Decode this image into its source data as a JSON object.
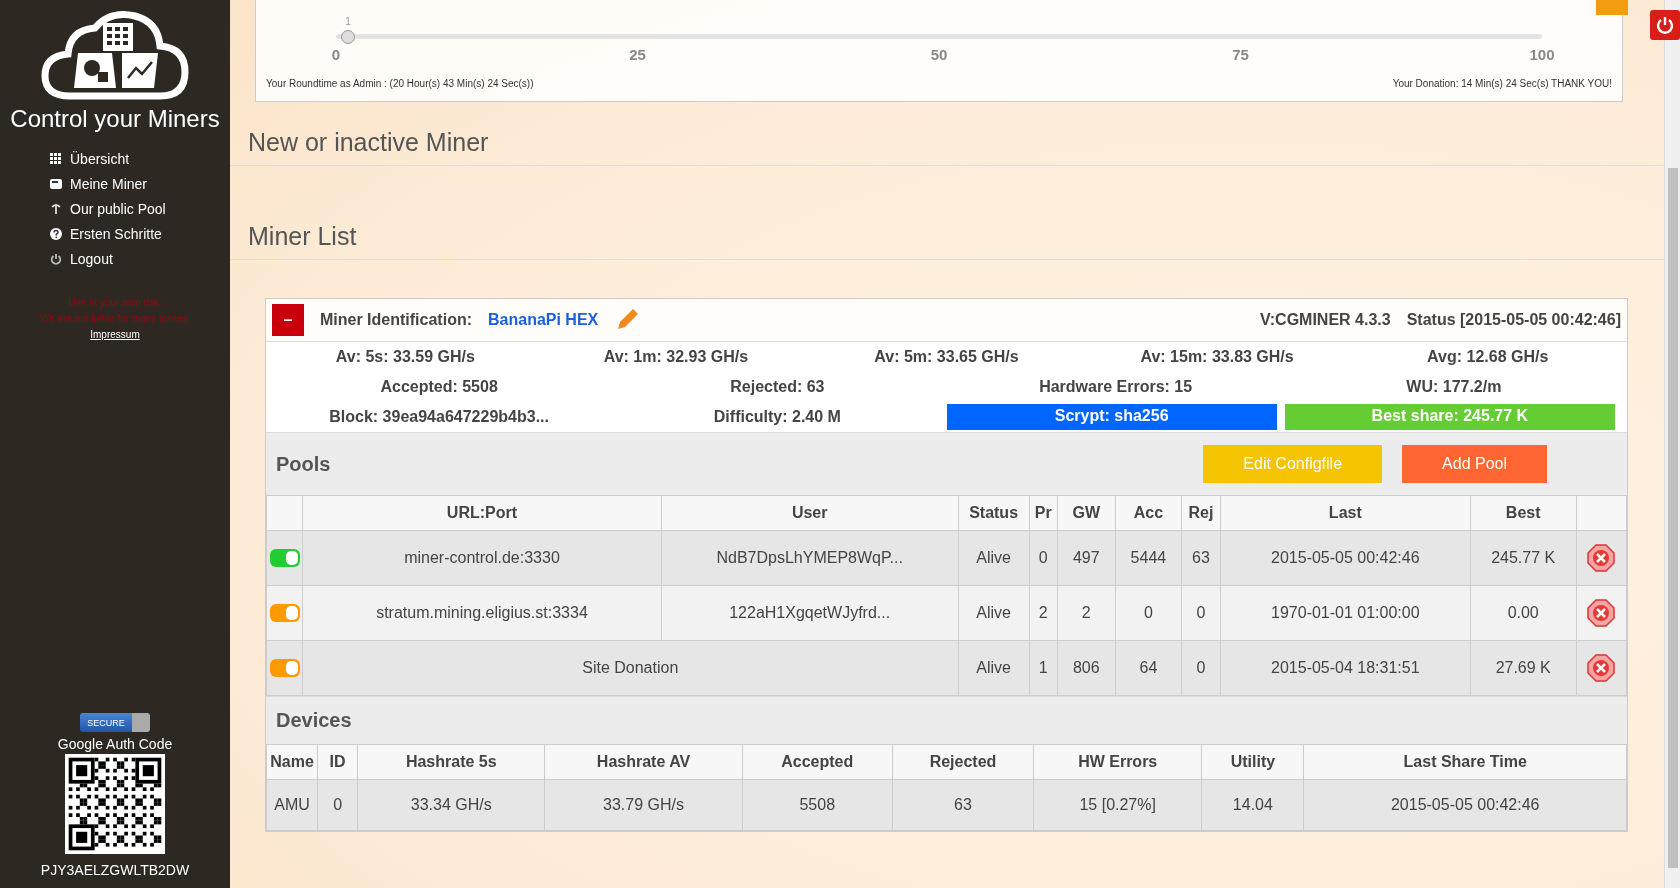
{
  "sidebar": {
    "brand": "Control your Miners",
    "nav": [
      {
        "label": "Übersicht",
        "kind": "grid"
      },
      {
        "label": "Meine Miner",
        "kind": "card"
      },
      {
        "label": "Our public Pool",
        "kind": "pick"
      },
      {
        "label": "Ersten Schritte",
        "kind": "help"
      },
      {
        "label": "Logout",
        "kind": "power"
      }
    ],
    "disclaimer": [
      "Use at your own risk.",
      "We are not liable for many losses."
    ],
    "impressum": "Impressum",
    "secure_toggle": {
      "label": "SECURE",
      "on": true
    },
    "auth_label": "Google Auth Code",
    "auth_code": "PJY3AELZGWLTB2DW"
  },
  "donation": {
    "value": "1",
    "level": 0.01,
    "ticks": [
      "0",
      "25",
      "50",
      "75",
      "100"
    ],
    "roundtime": "Your Roundtime as Admin : (20 Hour(s) 43 Min(s) 24 Sec(s))",
    "thanks": "Your Donation: 14 Min(s) 24 Sec(s) THANK YOU!"
  },
  "sections": [
    "New or inactive Miner",
    "Miner List"
  ],
  "miner": {
    "collapse": "–",
    "id_label": "Miner Identification:",
    "name": "BananaPi HEX",
    "version": "V:CGMINER 4.3.3",
    "status": "Status [2015-05-05 00:42:46]",
    "stats": [
      [
        {
          "kind": "text",
          "text": "Av: 5s: 33.59 GH/s"
        },
        {
          "kind": "text",
          "text": "Av: 1m: 32.93 GH/s"
        },
        {
          "kind": "text",
          "text": "Av: 5m: 33.65 GH/s"
        },
        {
          "kind": "text",
          "text": "Av: 15m: 33.83 GH/s"
        },
        {
          "kind": "text",
          "text": "Avg: 12.68 GH/s"
        }
      ],
      [
        {
          "kind": "text",
          "text": "Accepted: 5508"
        },
        {
          "kind": "text",
          "text": "Rejected: 63"
        },
        {
          "kind": "text",
          "text": "Hardware Errors: 15"
        },
        {
          "kind": "text",
          "text": "WU: 177.2/m"
        }
      ],
      [
        {
          "kind": "text",
          "text": "Block: 39ea94a647229b4b3..."
        },
        {
          "kind": "text",
          "text": "Difficulty: 2.40 M"
        },
        {
          "kind": "badge",
          "text": "Scrypt: sha256",
          "color": "#0066ff"
        },
        {
          "kind": "badge",
          "text": "Best share: 245.77 K",
          "color": "#66cc33"
        }
      ]
    ],
    "pools": {
      "title": "Pools",
      "buttons": [
        {
          "label": "Edit Configfile",
          "color": "#f5c400"
        },
        {
          "label": "Add Pool",
          "color": "#ff6633"
        }
      ],
      "columns": [
        "URL:Port",
        "User",
        "Status",
        "Pr",
        "GW",
        "Acc",
        "Rej",
        "Last",
        "Best"
      ],
      "rows": [
        {
          "color": "#22cc33",
          "url": "miner-control.de:3330",
          "user": "NdB7DpsLhYMEP8WqP...",
          "status": "Alive",
          "pr": "0",
          "gw": "497",
          "acc": "5444",
          "rej": "63",
          "last": "2015-05-05 00:42:46",
          "best": "245.77 K"
        },
        {
          "color": "#ff9900",
          "url": "stratum.mining.eligius.st:3334",
          "user": "122aH1XgqetWJyfrd...",
          "status": "Alive",
          "pr": "2",
          "gw": "2",
          "acc": "0",
          "rej": "0",
          "last": "1970-01-01 01:00:00",
          "best": "0.00"
        },
        {
          "color": "#ff9900",
          "url": "Site Donation",
          "status": "Alive",
          "pr": "1",
          "gw": "806",
          "acc": "64",
          "rej": "0",
          "last": "2015-05-04 18:31:51",
          "best": "27.69 K"
        }
      ]
    },
    "devices": {
      "title": "Devices",
      "columns": [
        "Name",
        "ID",
        "Hashrate 5s",
        "Hashrate AV",
        "Accepted",
        "Rejected",
        "HW Errors",
        "Utility",
        "Last Share Time"
      ],
      "rows": [
        [
          "AMU",
          "0",
          "33.34 GH/s",
          "33.79 GH/s",
          "5508",
          "63",
          "15 [0.27%]",
          "14.04",
          "2015-05-05 00:42:46"
        ]
      ]
    }
  }
}
